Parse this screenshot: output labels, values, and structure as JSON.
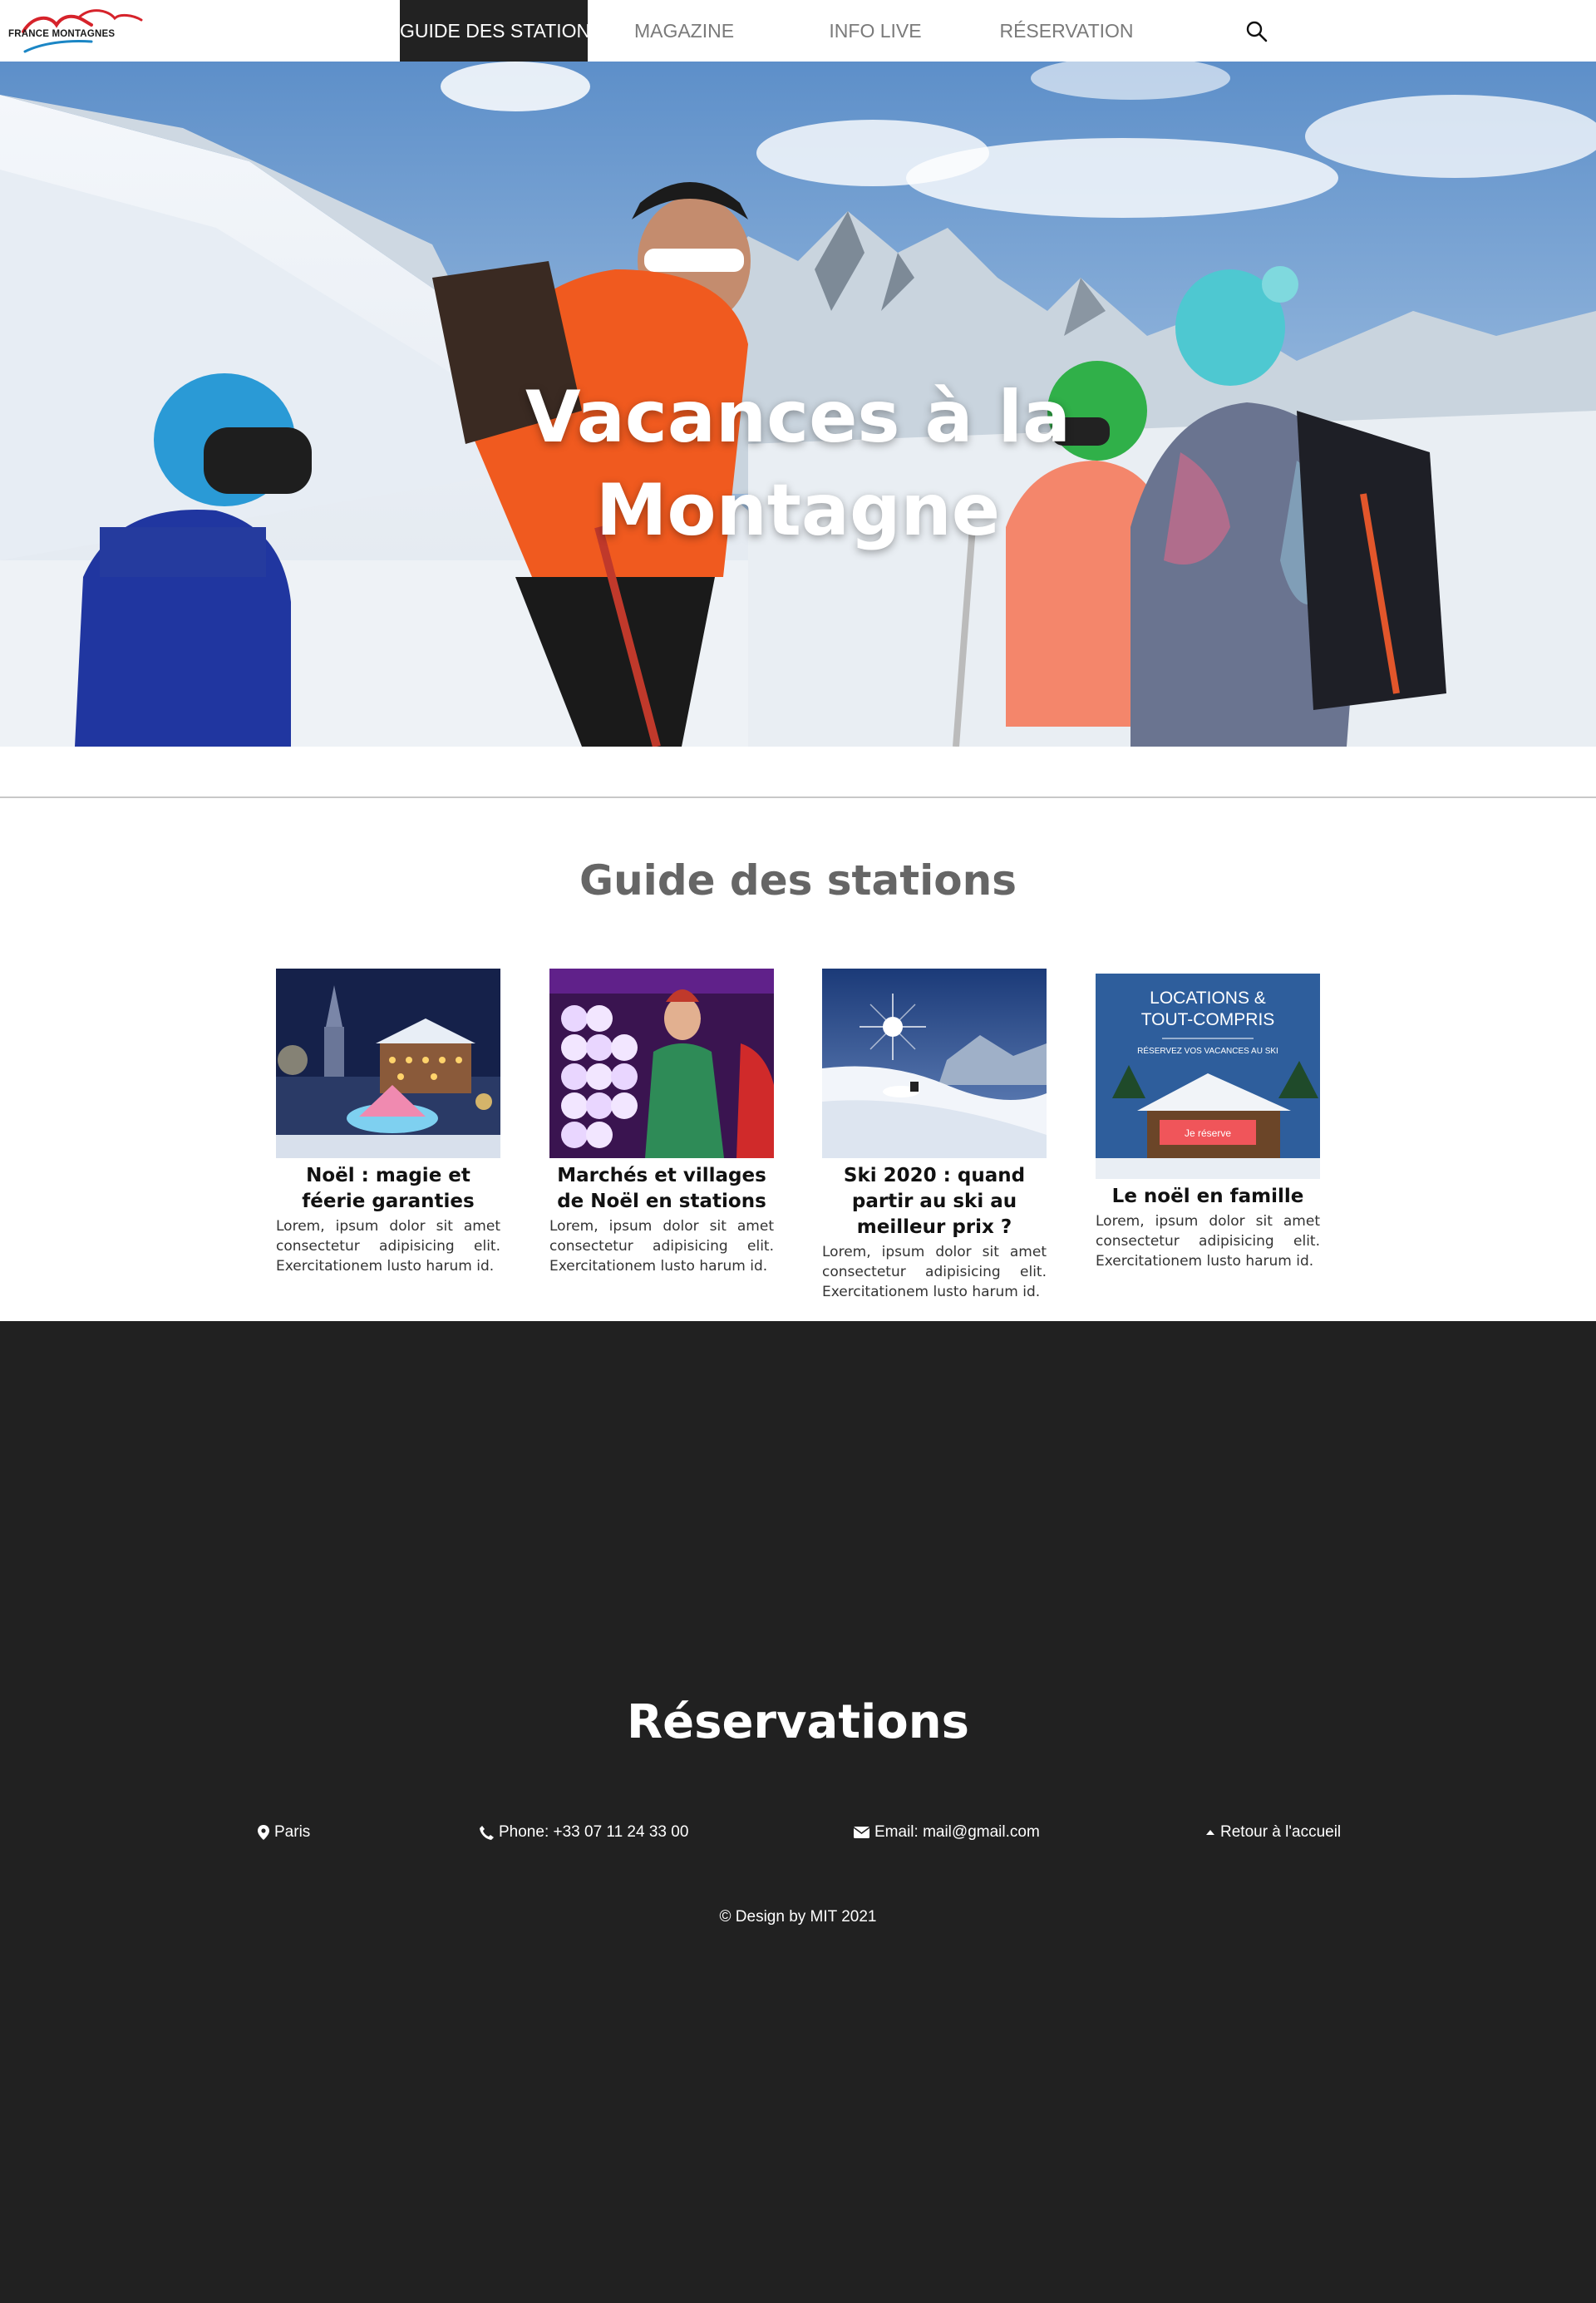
{
  "nav": {
    "logo_text": "FRANCE MONTAGNES",
    "items": [
      {
        "label": "GUIDE DES STATIONS",
        "active": true
      },
      {
        "label": "MAGAZINE",
        "active": false
      },
      {
        "label": "INFO LIVE",
        "active": false
      },
      {
        "label": "RÉSERVATION",
        "active": false
      }
    ],
    "search_icon": "search-icon"
  },
  "hero": {
    "title_line1": "Vacances à la",
    "title_line2": "Montagne"
  },
  "guide": {
    "title": "Guide des stations",
    "cards": [
      {
        "title": "Noël : magie et féerie garanties",
        "text": "Lorem, ipsum dolor sit amet consectetur adipisicing elit. Exercitationem lusto harum id."
      },
      {
        "title": "Marchés et villages de Noël en stations",
        "text": "Lorem, ipsum dolor sit amet consectetur adipisicing elit. Exercitationem lusto harum id."
      },
      {
        "title": "Ski 2020 : quand partir au ski au meilleur prix ?",
        "text": "Lorem, ipsum dolor sit amet consectetur adipisicing elit. Exercitationem lusto harum id."
      },
      {
        "title": "Le noël en famille",
        "text": "Lorem, ipsum dolor sit amet consectetur adipisicing elit. Exercitationem lusto harum id.",
        "image_text": {
          "line1": "LOCATIONS &",
          "line2": "TOUT-COMPRIS",
          "sub": "RÉSERVEZ VOS VACANCES AU SKI",
          "button": "Je réserve"
        }
      }
    ]
  },
  "footer": {
    "title": "Réservations",
    "location": "Paris",
    "phone": "Phone: +33 07 11 24 33 00",
    "email": "Email: mail@gmail.com",
    "back": "Retour à l'accueil",
    "copyright": "© Design by MIT 2021"
  },
  "colors": {
    "nav_active_bg": "#222222",
    "footer_bg": "#212121",
    "heading_gray": "#666666",
    "cta_red": "#f0555a"
  }
}
